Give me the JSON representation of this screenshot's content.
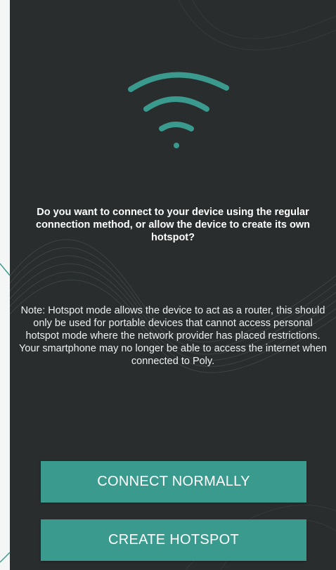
{
  "dialog": {
    "question": "Do you want to connect to your device using the regular connection method, or allow the device to create its own hotspot?",
    "note": "Note: Hotspot mode allows the device to act as a router, this should only be used for portable devices that cannot access personal hotspot mode where the network provider has placed restrictions. Your smartphone may no longer be able to access the internet when connected to Poly."
  },
  "buttons": {
    "connect_label": "CONNECT NORMALLY",
    "hotspot_label": "CREATE HOTSPOT"
  },
  "icons": {
    "status": "wifi-icon"
  },
  "colors": {
    "background": "#2a2d2e",
    "accent": "#3a9a8d",
    "text": "#ffffff"
  }
}
